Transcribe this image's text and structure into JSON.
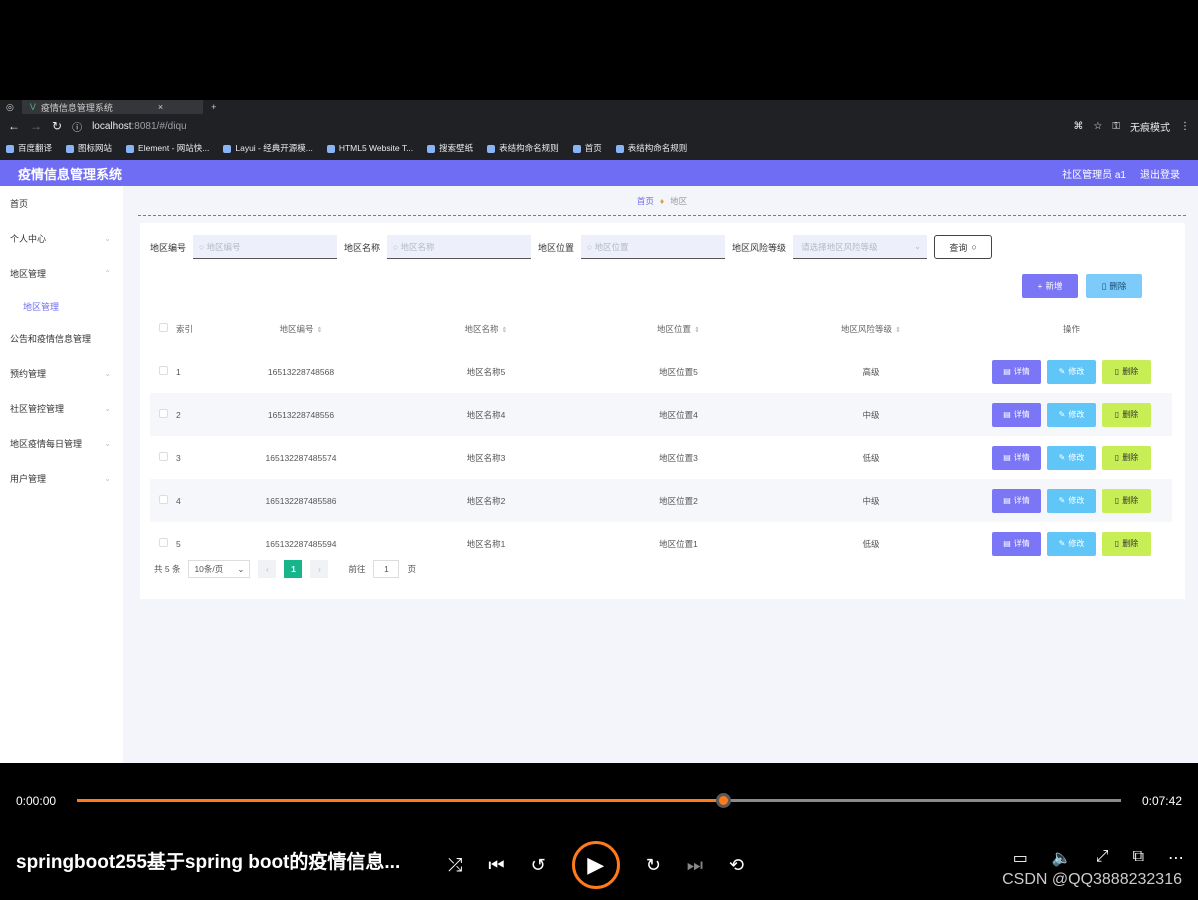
{
  "browser": {
    "tab_title": "疫情信息管理系统",
    "url_host": "localhost",
    "url_rest": ":8081/#/diqu",
    "profile": "无痕模式",
    "bookmarks": [
      "百度翻译",
      "图标网站",
      "Element - 网站快...",
      "Layui - 经典开源模...",
      "HTML5 Website T...",
      "搜索壁纸",
      "表结构命名规则",
      "首页",
      "表结构命名规则"
    ]
  },
  "header": {
    "title": "疫情信息管理系统",
    "user": "社区管理员 a1",
    "logout": "退出登录"
  },
  "sidebar": {
    "items": [
      {
        "label": "首页"
      },
      {
        "label": "个人中心"
      },
      {
        "label": "地区管理"
      },
      {
        "label": "地区管理"
      },
      {
        "label": "公告和疫情信息管理"
      },
      {
        "label": "预约管理"
      },
      {
        "label": "社区管控管理"
      },
      {
        "label": "地区疫情每日管理"
      },
      {
        "label": "用户管理"
      }
    ]
  },
  "breadcrumb": {
    "home": "首页",
    "current": "地区"
  },
  "search": {
    "code_label": "地区编号",
    "code_placeholder": "地区编号",
    "name_label": "地区名称",
    "name_placeholder": "地区名称",
    "loc_label": "地区位置",
    "loc_placeholder": "地区位置",
    "risk_label": "地区风险等级",
    "risk_placeholder": "请选择地区风险等级",
    "query": "查询"
  },
  "actions": {
    "add": "新增",
    "delete": "删除"
  },
  "table": {
    "headers": [
      "索引",
      "地区编号",
      "地区名称",
      "地区位置",
      "地区风险等级",
      "操作"
    ],
    "rows": [
      {
        "idx": "1",
        "code": "16513228748568",
        "name": "地区名称5",
        "loc": "地区位置5",
        "risk": "高级"
      },
      {
        "idx": "2",
        "code": "16513228748556",
        "name": "地区名称4",
        "loc": "地区位置4",
        "risk": "中级"
      },
      {
        "idx": "3",
        "code": "165132287485574",
        "name": "地区名称3",
        "loc": "地区位置3",
        "risk": "低级"
      },
      {
        "idx": "4",
        "code": "165132287485586",
        "name": "地区名称2",
        "loc": "地区位置2",
        "risk": "中级"
      },
      {
        "idx": "5",
        "code": "165132287485594",
        "name": "地区名称1",
        "loc": "地区位置1",
        "risk": "低级"
      }
    ],
    "op_detail": "详情",
    "op_edit": "修改",
    "op_delete": "删除"
  },
  "pager": {
    "total": "共 5 条",
    "size": "10条/页",
    "current": "1",
    "goto": "前往",
    "goto_value": "1",
    "page_unit": "页"
  },
  "player": {
    "elapsed": "0:00:00",
    "duration": "0:07:42",
    "progress": 0.619,
    "title": "springboot255基于spring boot的疫情信息...",
    "credit": "CSDN @QQ3888232316"
  }
}
